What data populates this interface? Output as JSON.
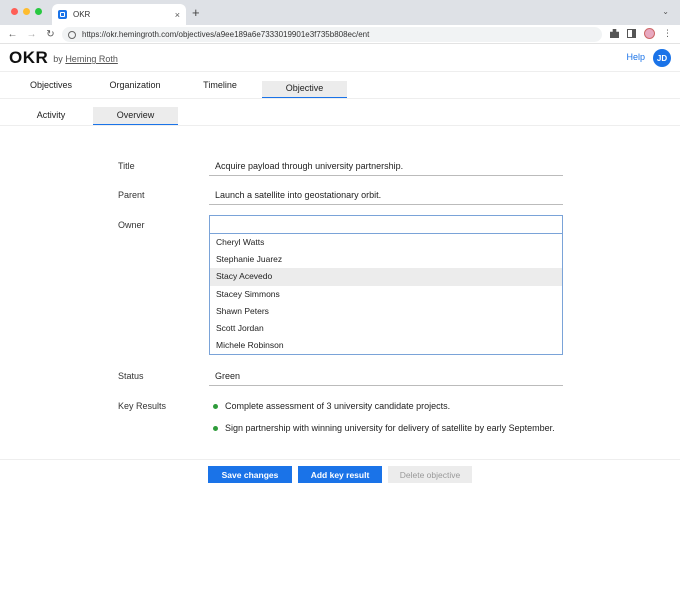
{
  "browser": {
    "tab_title": "OKR",
    "url": "https://okr.hemingroth.com/objectives/a9ee189a6e7333019901e3f735b808ec/ent",
    "new_tab_label": "+",
    "tab_close_label": "×",
    "tabstrip_menu_label": "⌄",
    "back_label": "←",
    "forward_label": "→",
    "reload_label": "↻",
    "more_label": "⋮"
  },
  "header": {
    "brand": "OKR",
    "by_prefix": "by",
    "by_name": "Heming Roth",
    "help": "Help",
    "avatar_initials": "JD"
  },
  "main_tabs": [
    {
      "label": "Objectives"
    },
    {
      "label": "Organization"
    },
    {
      "label": "Timeline"
    },
    {
      "label": "Objective"
    }
  ],
  "sub_tabs": [
    {
      "label": "Activity"
    },
    {
      "label": "Overview"
    }
  ],
  "form": {
    "title_label": "Title",
    "title_value": "Acquire payload through university partnership.",
    "parent_label": "Parent",
    "parent_value": "Launch a satellite into geostationary orbit.",
    "owner_label": "Owner",
    "owner_input": "",
    "owner_options": [
      "Cheryl Watts",
      "Stephanie Juarez",
      "Stacy Acevedo",
      "Stacey Simmons",
      "Shawn Peters",
      "Scott Jordan",
      "Michele Robinson"
    ],
    "status_label": "Status",
    "status_value": "Green",
    "key_results_label": "Key Results",
    "key_results": [
      "Complete assessment of 3 university candidate projects.",
      "Sign partnership with winning university for delivery of satellite by early September."
    ]
  },
  "actions": {
    "save": "Save changes",
    "add": "Add key result",
    "delete": "Delete objective"
  },
  "colors": {
    "accent": "#1a73e8",
    "status_green": "#2e9b3a"
  }
}
